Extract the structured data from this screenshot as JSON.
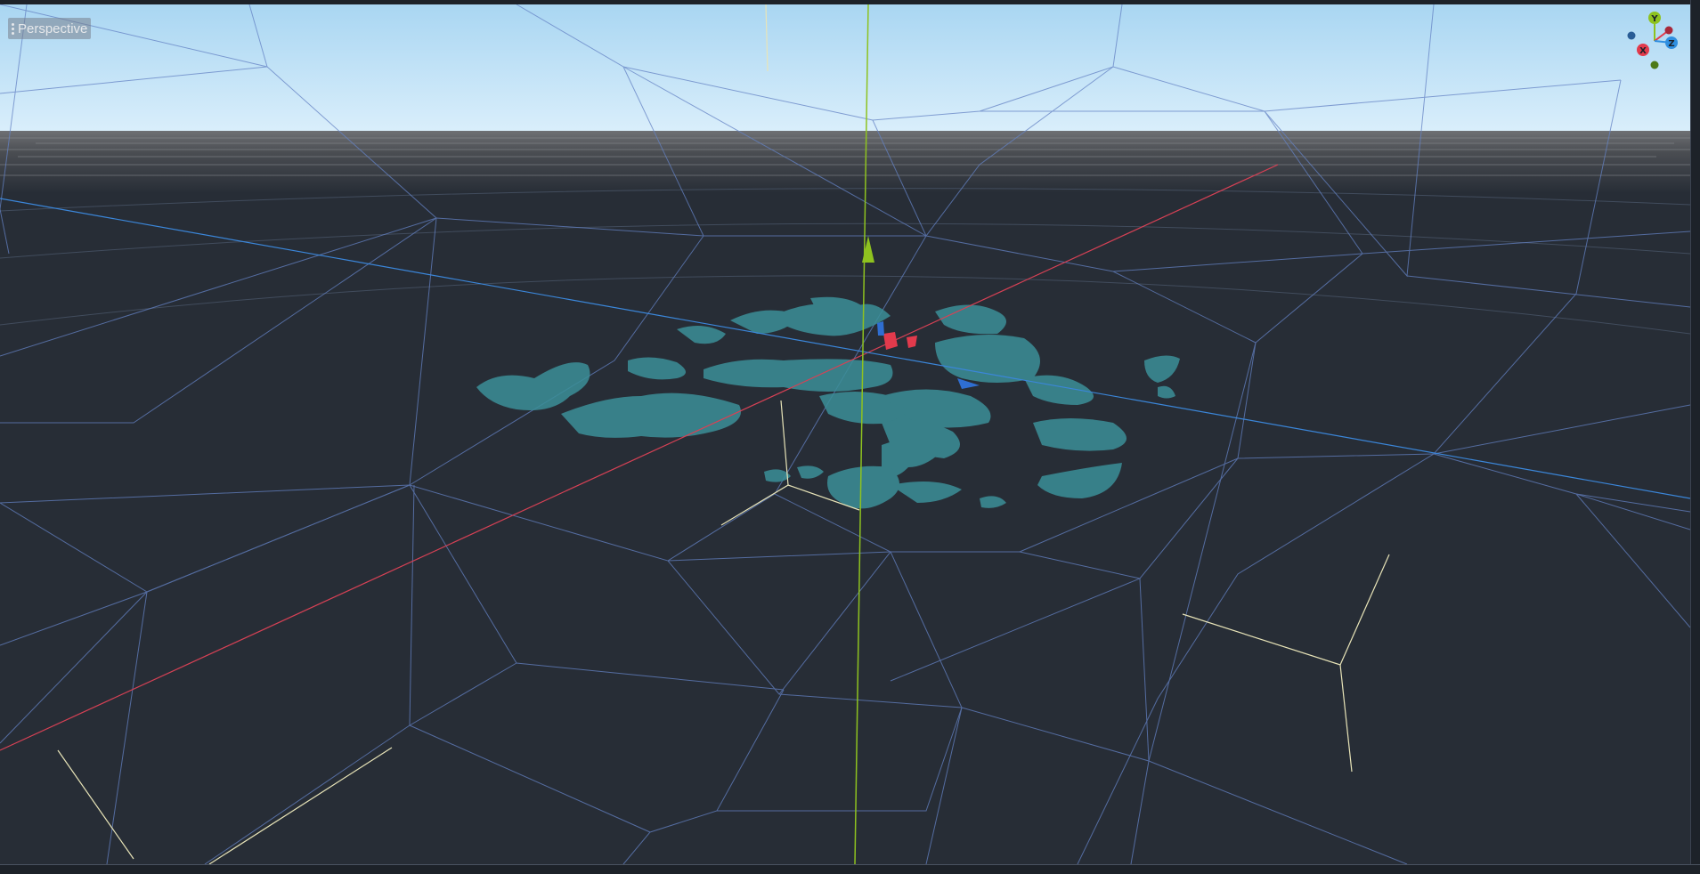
{
  "viewport": {
    "menu_label": "Perspective",
    "menu_icon": "kebab-menu-icon"
  },
  "gizmo": {
    "x_label": "X",
    "y_label": "Y",
    "z_label": "Z",
    "x_color": "#e23a4c",
    "y_color": "#8ec21f",
    "z_color": "#2f8fe0"
  },
  "colors": {
    "sky_top": "#a9d6f2",
    "sky_bottom": "#d6ecf9",
    "ground": "#272d36",
    "wireframe": "#5c78b8",
    "water": "#3b8f98"
  }
}
